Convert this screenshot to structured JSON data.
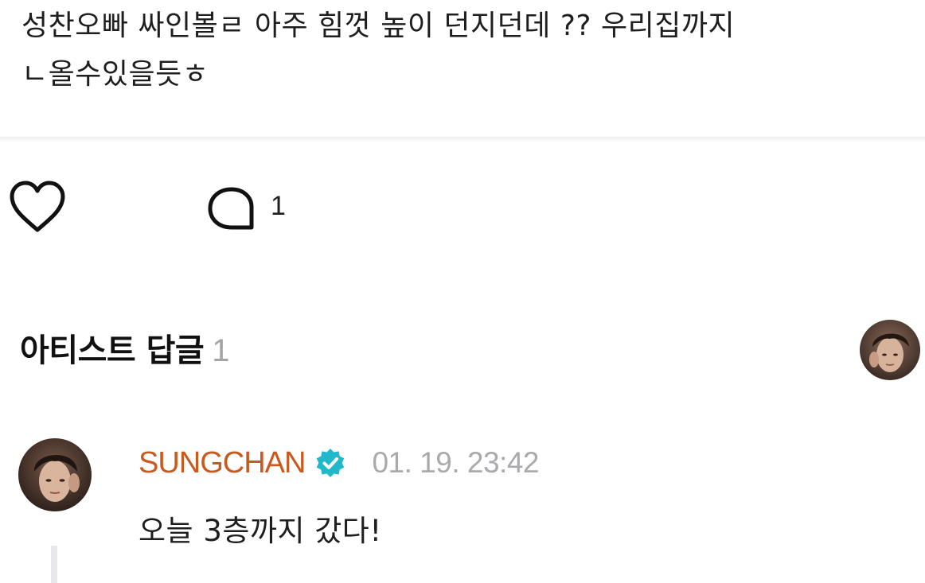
{
  "post": {
    "line1": "성찬오빠 싸인볼ㄹ 아주 힘껏 높이 던지던데 ?? 우리집까지",
    "line2": "ㄴ올수있을듯ㅎ"
  },
  "actions": {
    "like_icon": "heart-outline-icon",
    "comment_icon": "comment-bubble-icon",
    "comment_count": "1"
  },
  "artist_replies": {
    "title": "아티스트 답글",
    "count": "1"
  },
  "reply": {
    "author": "SUNGCHAN",
    "verified_icon": "verified-badge-icon",
    "timestamp": "01. 19. 23:42",
    "text": "오늘 3층까지 갔다!"
  },
  "colors": {
    "author": "#c85a20",
    "verified": "#21b8c9",
    "muted": "#a9a9ae"
  }
}
